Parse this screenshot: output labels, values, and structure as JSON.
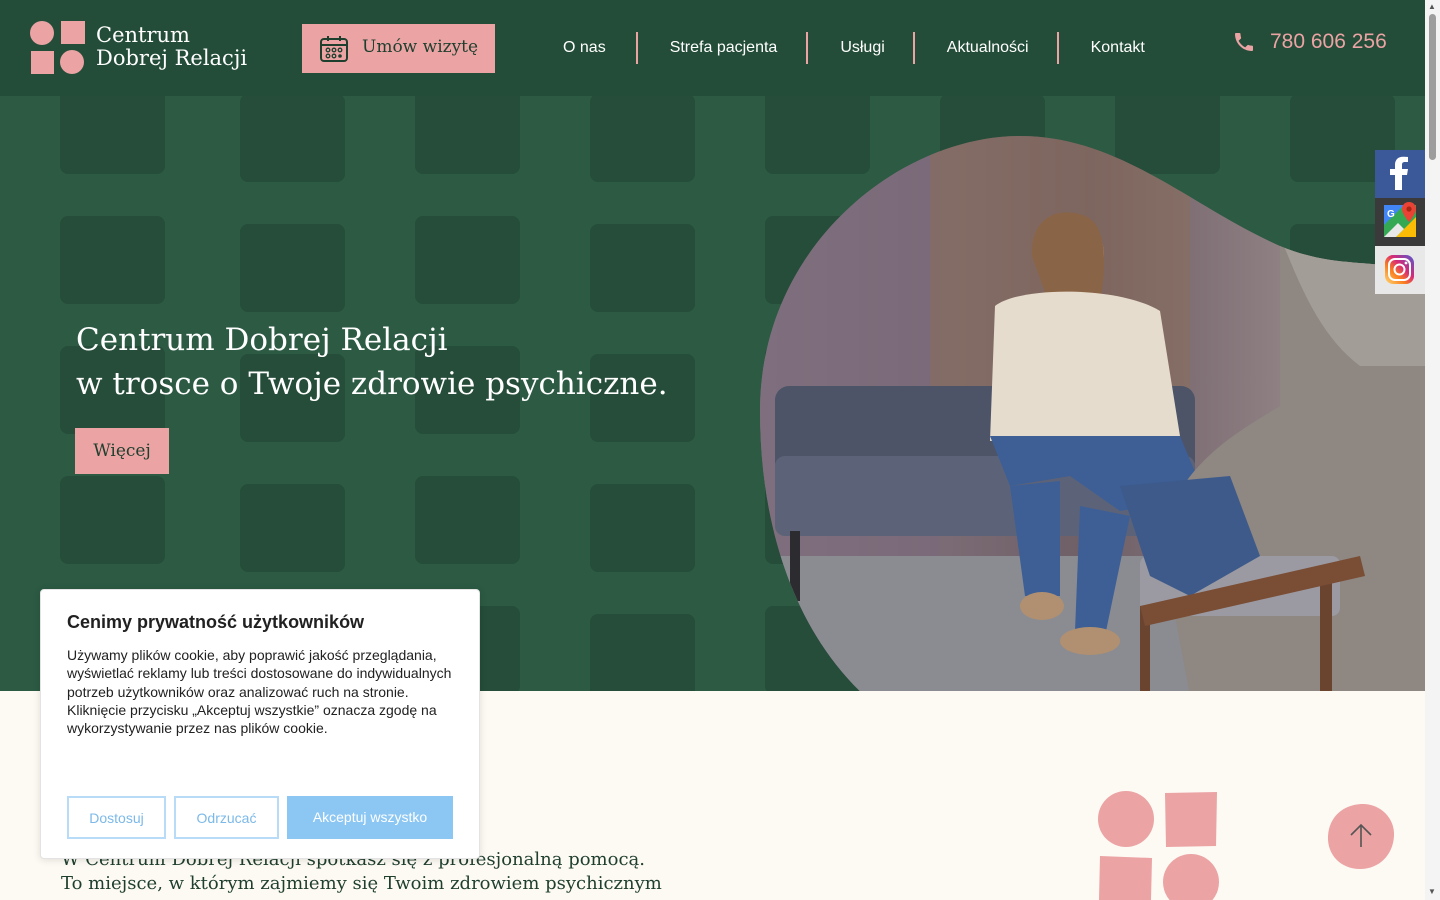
{
  "header": {
    "logo_line1": "Centrum",
    "logo_line2": "Dobrej Relacji",
    "book_button": "Umów wizytę",
    "nav": [
      "O nas",
      "Strefa pacjenta",
      "Usługi",
      "Aktualności",
      "Kontakt"
    ],
    "phone": "780 606 256"
  },
  "hero": {
    "title_line1": "Centrum Dobrej Relacji",
    "title_line2": "w trosce o Twoje zdrowie psychiczne.",
    "more_button": "Więcej"
  },
  "intro": {
    "line1": "W Centrum Dobrej Relacji spotkasz się z profesjonalną pomocą.",
    "line2": "To miejsce, w którym zajmiemy się Twoim zdrowiem psychicznym"
  },
  "cookie": {
    "title": "Cenimy prywatność użytkowników",
    "text": "Używamy plików cookie, aby poprawić jakość przeglądania, wyświetlać reklamy lub treści dostosowane do indywidualnych potrzeb użytkowników oraz analizować ruch na stronie. Kliknięcie przycisku „Akceptuj wszystkie” oznacza zgodę na wykorzystywanie przez nas plików cookie.",
    "customize": "Dostosuj",
    "reject": "Odrzucać",
    "accept": "Akceptuj wszystko"
  },
  "social": [
    "facebook-icon",
    "google-maps-icon",
    "instagram-icon"
  ],
  "colors": {
    "dark_green": "#234d38",
    "hero_green": "#2c5a43",
    "pink": "#eba3a4",
    "cookie_blue": "#8cc7f4",
    "cream": "#fdf9f3"
  }
}
